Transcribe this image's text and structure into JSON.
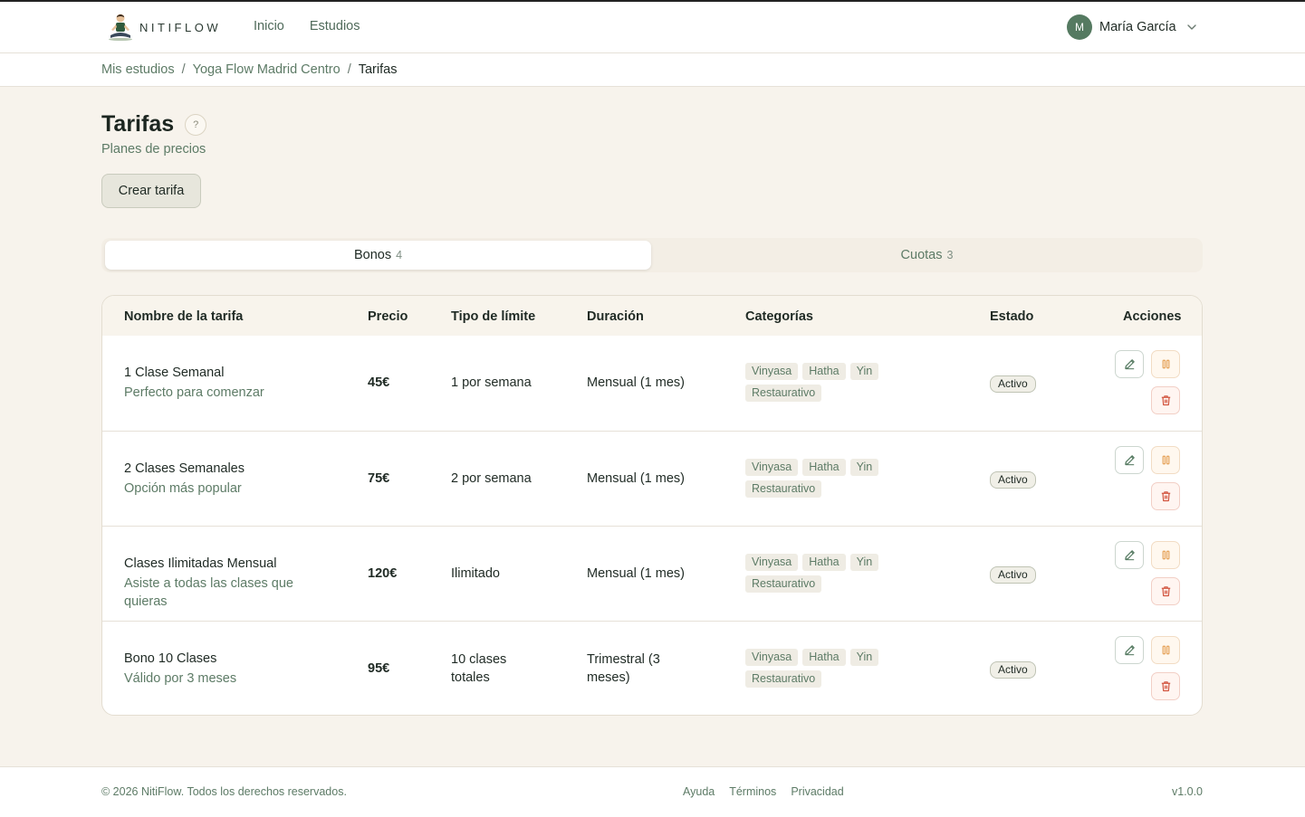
{
  "header": {
    "logo_text": "NITIFLOW",
    "nav": [
      {
        "label": "Inicio"
      },
      {
        "label": "Estudios"
      }
    ],
    "user": {
      "initial": "M",
      "name": "María García"
    }
  },
  "breadcrumb": {
    "items": [
      "Mis estudios",
      "Yoga Flow Madrid Centro",
      "Tarifas"
    ],
    "separator": "/"
  },
  "page": {
    "title": "Tarifas",
    "help": "?",
    "subtitle": "Planes de precios",
    "create_label": "Crear tarifa"
  },
  "tabs": [
    {
      "label": "Bonos",
      "count": "4",
      "active": true
    },
    {
      "label": "Cuotas",
      "count": "3",
      "active": false
    }
  ],
  "table": {
    "columns": [
      "Nombre de la tarifa",
      "Precio",
      "Tipo de límite",
      "Duración",
      "Categorías",
      "Estado",
      "Acciones"
    ],
    "rows": [
      {
        "name": "1 Clase Semanal",
        "desc": "Perfecto para comenzar",
        "price": "45€",
        "limit": "1 por semana",
        "duration": "Mensual (1 mes)",
        "categories": [
          "Vinyasa",
          "Hatha",
          "Yin",
          "Restaurativo"
        ],
        "status": "Activo"
      },
      {
        "name": "2 Clases Semanales",
        "desc": "Opción más popular",
        "price": "75€",
        "limit": "2 por semana",
        "duration": "Mensual (1 mes)",
        "categories": [
          "Vinyasa",
          "Hatha",
          "Yin",
          "Restaurativo"
        ],
        "status": "Activo"
      },
      {
        "name": "Clases Ilimitadas Mensual",
        "desc": "Asiste a todas las clases que quieras",
        "price": "120€",
        "limit": "Ilimitado",
        "duration": "Mensual (1 mes)",
        "categories": [
          "Vinyasa",
          "Hatha",
          "Yin",
          "Restaurativo"
        ],
        "status": "Activo"
      },
      {
        "name": "Bono 10 Clases",
        "desc": "Válido por 3 meses",
        "price": "95€",
        "limit": "10 clases totales",
        "duration": "Trimestral (3 meses)",
        "categories": [
          "Vinyasa",
          "Hatha",
          "Yin",
          "Restaurativo"
        ],
        "status": "Activo"
      }
    ]
  },
  "footer": {
    "copyright": "© 2026 NitiFlow. Todos los derechos reservados.",
    "links": [
      "Ayuda",
      "Términos",
      "Privacidad"
    ],
    "version": "v1.0.0"
  },
  "colors": {
    "accent": "#557a61",
    "background": "#f7f3ec",
    "pause": "#e6a35a",
    "delete": "#d2553f"
  },
  "icons": {
    "edit": "pencil-icon",
    "pause": "pause-icon",
    "delete": "trash-icon",
    "chevron": "chevron-down-icon",
    "help": "help-icon"
  }
}
